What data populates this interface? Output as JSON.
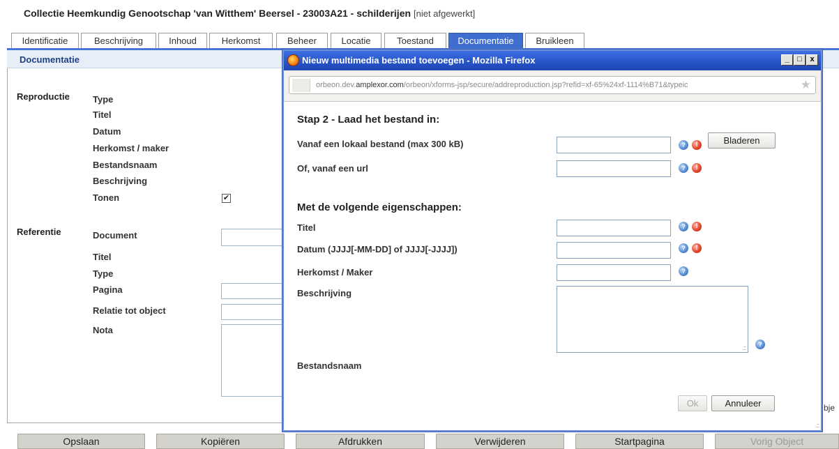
{
  "page": {
    "title": "Collectie Heemkundig Genootschap 'van Witthem' Beersel - 23003A21  - schilderijen",
    "status": "[niet afgewerkt]"
  },
  "tabs": [
    "Identificatie",
    "Beschrijving",
    "Inhoud",
    "Herkomst",
    "Beheer",
    "Locatie",
    "Toestand",
    "Documentatie",
    "Bruikleen"
  ],
  "active_tab": "Documentatie",
  "section": {
    "title": "Documentatie"
  },
  "form": {
    "reproductie": {
      "label": "Reproductie",
      "fields": [
        "Type",
        "Titel",
        "Datum",
        "Herkomst / maker",
        "Bestandsnaam",
        "Beschrijving",
        "Tonen"
      ],
      "tonen_checked": true,
      "check_glyph": "✔"
    },
    "referentie": {
      "label": "Referentie",
      "fields": [
        "Document",
        "Titel",
        "Type",
        "Pagina",
        "Relatie tot object",
        "Nota"
      ]
    },
    "clipped_text": "bje"
  },
  "bottom_buttons": [
    {
      "label": "Opslaan",
      "disabled": false
    },
    {
      "label": "Kopiëren",
      "disabled": false
    },
    {
      "label": "Afdrukken",
      "disabled": false
    },
    {
      "label": "Verwijderen",
      "disabled": false
    },
    {
      "label": "Startpagina",
      "disabled": false
    },
    {
      "label": "Vorig Object",
      "disabled": true
    }
  ],
  "dialog": {
    "window_title": "Nieuw multimedia bestand toevoegen - Mozilla Firefox",
    "window_buttons": {
      "minimize": "_",
      "maximize": "□",
      "close": "x"
    },
    "url_host": "orbeon.dev.",
    "url_domain": "amplexor.com",
    "url_path": "/orbeon/xforms-jsp/secure/addreproduction.jsp?refid=xf-65%24xf-1114%B71&typeic",
    "step_heading": "Stap 2 - Laad het bestand in:",
    "local_file_label": "Vanaf een lokaal bestand",
    "local_file_note": "(max 300 kB)",
    "browse_button": "Bladeren",
    "url_label": "Of, vanaf een url",
    "properties_heading": "Met de volgende eigenschappen:",
    "title_label": "Titel",
    "date_label": "Datum (JJJJ[-MM-DD] of JJJJ[-JJJJ])",
    "origin_label": "Herkomst / Maker",
    "description_label": "Beschrijving",
    "filename_label": "Bestandsnaam",
    "ok_button": "Ok",
    "cancel_button": "Annuleer",
    "help_glyph": "?",
    "alert_glyph": "!",
    "grip_glyph": ".::"
  },
  "colors": {
    "accent": "#3f6ed0",
    "titlebar": "#2855c9",
    "section_bg": "#e8eef8",
    "help_icon": "#5b8fd6",
    "alert_icon": "#e5472e"
  }
}
